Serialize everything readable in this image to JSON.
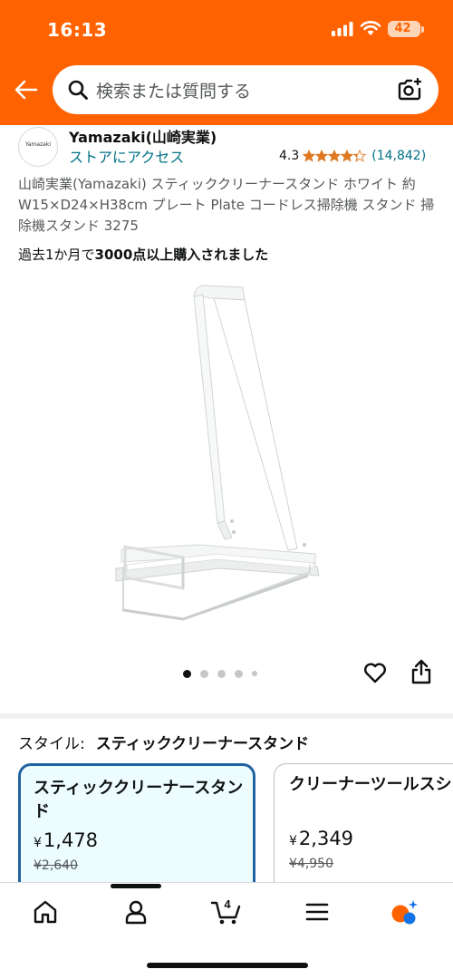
{
  "status_bar": {
    "time": "16:13",
    "battery": "42"
  },
  "search": {
    "placeholder": "検索または質問する"
  },
  "store": {
    "logo_text": "Yamazaki",
    "name": "Yamazaki(山崎実業)",
    "link": "ストアにアクセス",
    "rating": "4.3",
    "stars": 4.3,
    "review_count": "(14,842)"
  },
  "product": {
    "title": "山崎実業(Yamazaki) スティッククリーナースタンド ホワイト 約W15×D24×H38cm プレート Plate コードレス掃除機 スタンド 掃除機スタンド 3275",
    "bought_prefix": "過去1か月で",
    "bought_bold": "3000点以上購入されました"
  },
  "carousel": {
    "total": 5,
    "active": 1
  },
  "style": {
    "label": "スタイル:",
    "value": "スティッククリーナースタンド",
    "options": [
      {
        "name": "スティッククリーナースタンド",
        "price": "1,478",
        "old_price": "¥2,640",
        "currency": "¥"
      },
      {
        "name": "クリーナーツールスション",
        "price": "2,349",
        "old_price": "¥4,950",
        "currency": "¥"
      }
    ]
  },
  "bottom_nav": {
    "cart_count": "4",
    "items": [
      "home-icon",
      "account-icon",
      "cart-icon",
      "menu-icon",
      "assistant-icon"
    ]
  },
  "colors": {
    "header": "#ff6200",
    "link": "#007185",
    "star": "#de7921",
    "selected_border": "#2162a1"
  }
}
